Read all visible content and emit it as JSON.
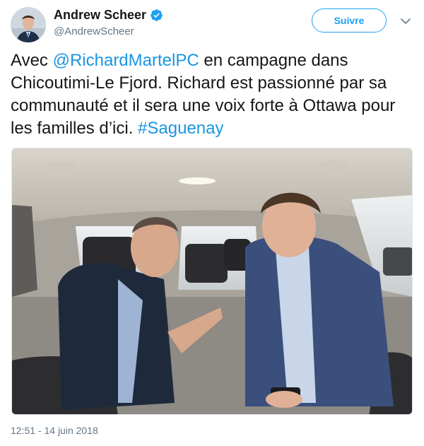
{
  "user": {
    "display_name": "Andrew Scheer",
    "handle": "@AndrewScheer",
    "verified": true
  },
  "actions": {
    "follow_label": "Suivre"
  },
  "tweet": {
    "text_before": "Avec ",
    "mention": "@RichardMartelPC",
    "text_middle": " en campagne dans Chicoutimi-Le Fjord. Richard est passionné par sa communauté et il sera une voix forte à Ottawa pour les familles d’ici. ",
    "hashtag": "#Saguenay",
    "timestamp": "12:51 - 14 juin 2018"
  },
  "colors": {
    "link": "#1b95e0",
    "accent": "#1da1f2",
    "muted": "#657786"
  }
}
